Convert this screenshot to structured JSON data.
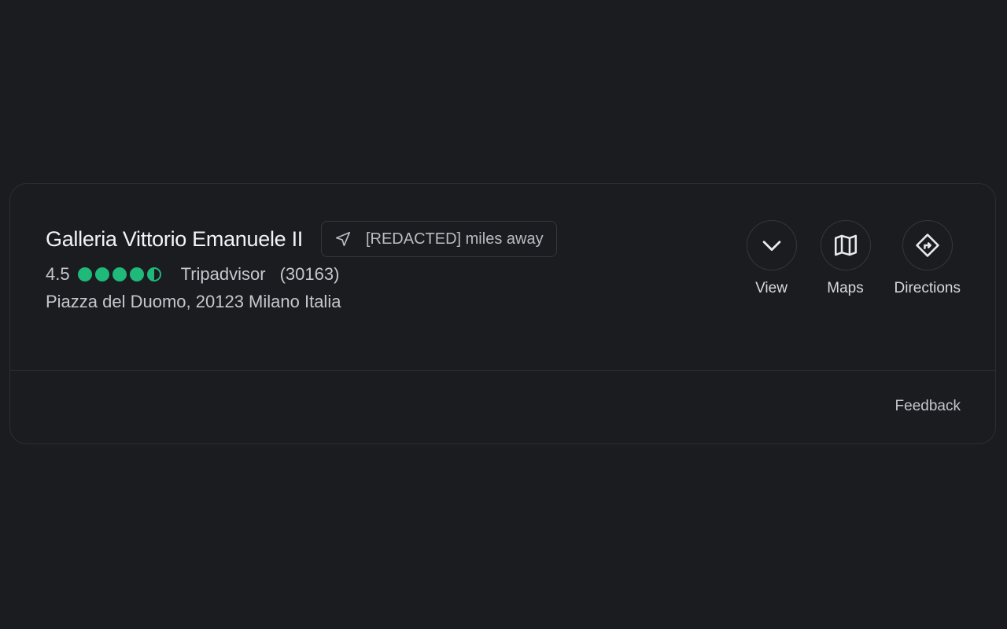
{
  "place": {
    "name": "Galleria Vittorio Emanuele II",
    "distance": "[REDACTED] miles away",
    "rating": "4.5",
    "rating_stars": 4.5,
    "rating_source": "Tripadvisor",
    "review_count": "(30163)",
    "address": "Piazza del Duomo, 20123 Milano Italia"
  },
  "actions": {
    "view_label": "View",
    "maps_label": "Maps",
    "directions_label": "Directions"
  },
  "footer": {
    "feedback_label": "Feedback"
  },
  "colors": {
    "background": "#1b1c20",
    "rating_green": "#1fb97a",
    "border": "#2c2e33"
  },
  "icons": {
    "distance": "navigation-arrow-icon",
    "view": "chevron-down-icon",
    "maps": "map-icon",
    "directions": "directions-icon"
  }
}
